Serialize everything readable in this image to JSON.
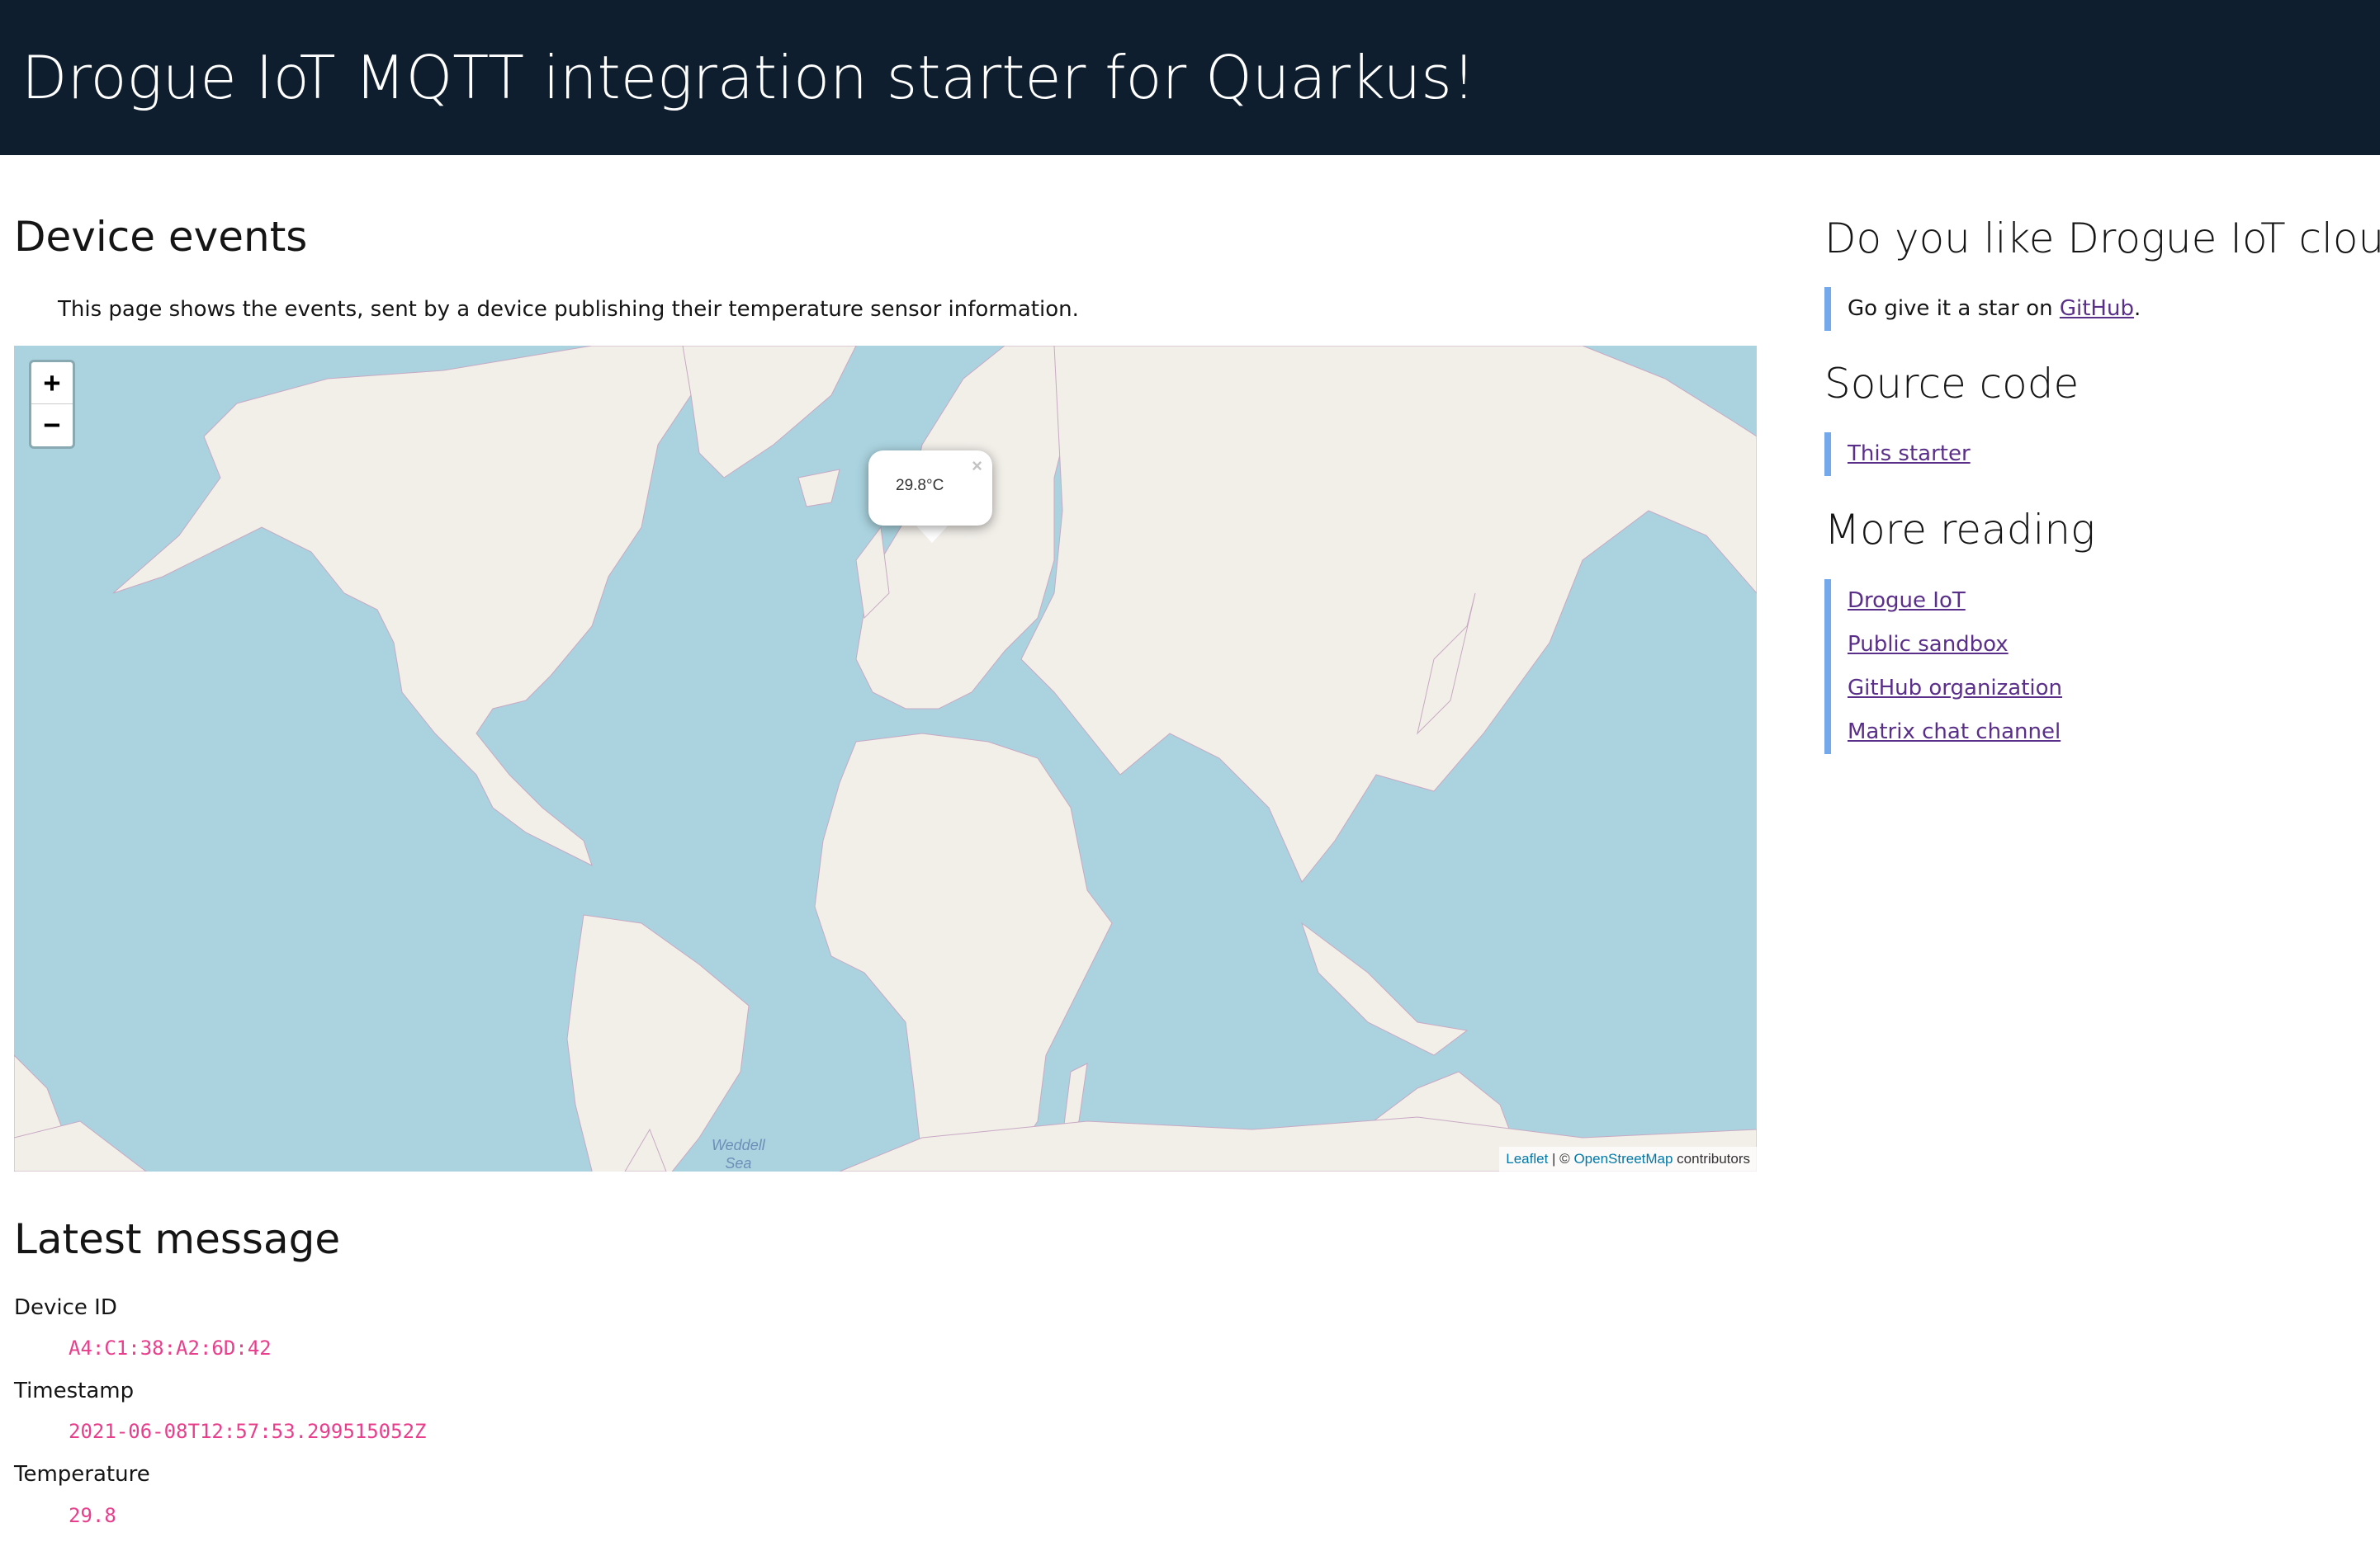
{
  "header": {
    "title": "Drogue IoT MQTT integration starter for Quarkus!"
  },
  "main": {
    "title": "Device events",
    "intro": "This page shows the events, sent by a device publishing their temperature sensor information.",
    "map": {
      "zoom_in_label": "+",
      "zoom_out_label": "−",
      "popup_text": "29.8°C",
      "popup_close": "×",
      "sea_label_line1": "Weddell",
      "sea_label_line2": "Sea",
      "attribution": {
        "leaflet": "Leaflet",
        "separator": " | © ",
        "osm": "OpenStreetMap",
        "suffix": " contributors"
      },
      "colors": {
        "sea": "#aad3df",
        "land": "#f2efe9",
        "border": "#c8a9c4"
      }
    },
    "latest": {
      "title": "Latest message",
      "fields": [
        {
          "label": "Device ID",
          "value": "A4:C1:38:A2:6D:42"
        },
        {
          "label": "Timestamp",
          "value": "2021-06-08T12:57:53.299515052Z"
        },
        {
          "label": "Temperature",
          "value": "29.8"
        }
      ]
    }
  },
  "sidebar": {
    "like": {
      "title": "Do you like Drogue IoT cloud?",
      "text_before": "Go give it a star on ",
      "link": "GitHub",
      "text_after": "."
    },
    "source": {
      "title": "Source code",
      "link": "This starter"
    },
    "reading": {
      "title": "More reading",
      "links": [
        "Drogue IoT",
        "Public sandbox",
        "GitHub organization",
        "Matrix chat channel"
      ]
    }
  },
  "colors": {
    "header_bg": "#0f1e2e",
    "link": "#5a2f8a",
    "accent_bar": "#73a9ea",
    "code": "#e83e8c"
  }
}
